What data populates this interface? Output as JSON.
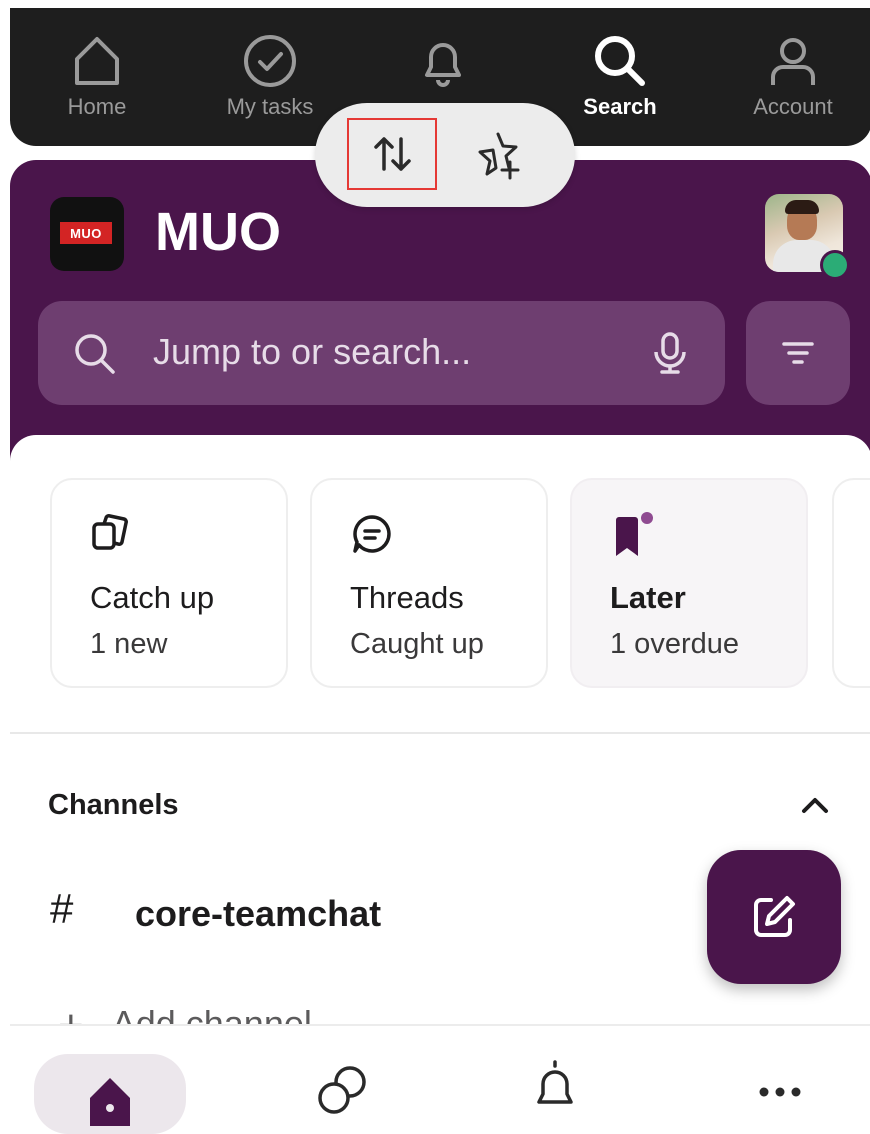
{
  "top_nav": {
    "items": [
      {
        "label": "Home",
        "icon": "home-outline-icon"
      },
      {
        "label": "My tasks",
        "icon": "check-circle-icon"
      },
      {
        "label": "",
        "icon": "bell-icon"
      },
      {
        "label": "Search",
        "icon": "search-icon"
      },
      {
        "label": "Account",
        "icon": "person-icon"
      }
    ],
    "active": "Search"
  },
  "pill": {
    "sort_icon": "sort-arrows-icon",
    "star_icon": "star-add-icon"
  },
  "workspace": {
    "name": "MUO",
    "logo_text": "MUO"
  },
  "search": {
    "placeholder": "Jump to or search..."
  },
  "cards": [
    {
      "title": "Catch up",
      "subtitle": "1 new",
      "icon": "copy-icon"
    },
    {
      "title": "Threads",
      "subtitle": "Caught up",
      "icon": "thread-icon"
    },
    {
      "title": "Later",
      "subtitle": "1 overdue",
      "icon": "bookmark-icon"
    }
  ],
  "channels": {
    "section_title": "Channels",
    "items": [
      {
        "name": "core-teamchat"
      }
    ],
    "add_label": "Add channel"
  },
  "colors": {
    "aubergine": "#4a154b",
    "search_bg": "#6e3e70",
    "presence": "#2bac76",
    "highlight": "#e53935"
  }
}
